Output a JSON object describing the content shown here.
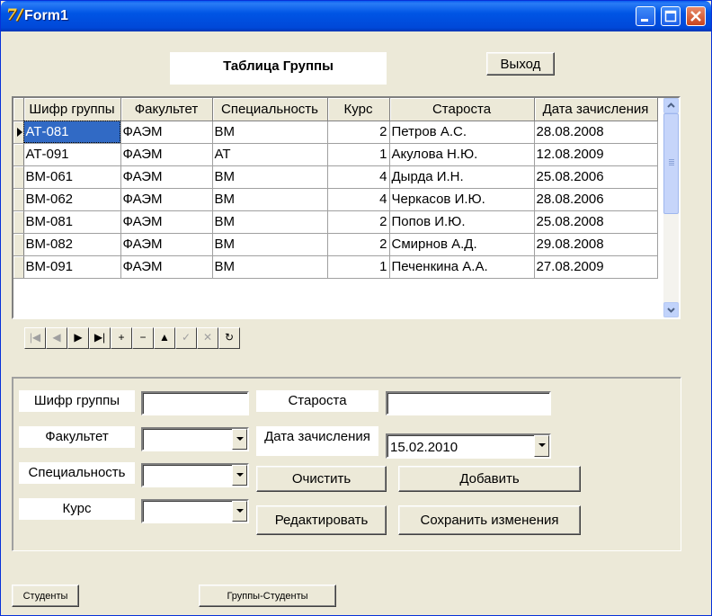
{
  "window": {
    "title": "Form1",
    "app_icon_glyph": "7/",
    "icons": [
      "delphi-app-icon",
      "minimize-icon",
      "maximize-icon",
      "close-icon"
    ]
  },
  "caption": "Таблица Группы",
  "exit_button": "Выход",
  "grid": {
    "columns": [
      "Шифр группы",
      "Факультет",
      "Специальность",
      "Курс",
      "Староста",
      "Дата зачисления"
    ],
    "rows": [
      [
        "АТ-081",
        "ФАЭМ",
        "ВМ",
        "2",
        "Петров А.С.",
        "28.08.2008"
      ],
      [
        "АТ-091",
        "ФАЭМ",
        "АТ",
        "1",
        "Акулова Н.Ю.",
        "12.08.2009"
      ],
      [
        "ВМ-061",
        "ФАЭМ",
        "ВМ",
        "4",
        "Дырда И.Н.",
        "25.08.2006"
      ],
      [
        "ВМ-062",
        "ФАЭМ",
        "ВМ",
        "4",
        "Черкасов И.Ю.",
        "28.08.2006"
      ],
      [
        "ВМ-081",
        "ФАЭМ",
        "ВМ",
        "2",
        "Попов И.Ю.",
        "25.08.2008"
      ],
      [
        "ВМ-082",
        "ФАЭМ",
        "ВМ",
        "2",
        "Смирнов А.Д.",
        "29.08.2008"
      ],
      [
        "ВМ-091",
        "ФАЭМ",
        "ВМ",
        "1",
        "Печенкина А.А.",
        "27.08.2009"
      ]
    ],
    "selected_cell": "АТ-081"
  },
  "navigator": {
    "buttons": [
      {
        "name": "first",
        "glyph": "|◀",
        "enabled": false
      },
      {
        "name": "prior",
        "glyph": "◀",
        "enabled": false
      },
      {
        "name": "next",
        "glyph": "▶",
        "enabled": true
      },
      {
        "name": "last",
        "glyph": "▶|",
        "enabled": true
      },
      {
        "name": "insert",
        "glyph": "+",
        "enabled": true
      },
      {
        "name": "delete",
        "glyph": "−",
        "enabled": true
      },
      {
        "name": "edit",
        "glyph": "▲",
        "enabled": true
      },
      {
        "name": "post",
        "glyph": "✓",
        "enabled": false
      },
      {
        "name": "cancel",
        "glyph": "✕",
        "enabled": false
      },
      {
        "name": "refresh",
        "glyph": "↻",
        "enabled": true
      }
    ]
  },
  "form": {
    "group_code_label": "Шифр группы",
    "group_code_value": "",
    "faculty_label": "Факультет",
    "faculty_value": "",
    "specialty_label": "Специальность",
    "specialty_value": "",
    "course_label": "Курс",
    "course_value": "",
    "headman_label": "Староста",
    "headman_value": "",
    "enroll_date_label": "Дата зачисления",
    "enroll_date_value": "15.02.2010",
    "clear_button": "Очистить",
    "add_button": "Добавить",
    "edit_button": "Редактировать",
    "save_button": "Сохранить изменения"
  },
  "bottom": {
    "students_button": "Студенты",
    "groups_students_button": "Группы-Студенты"
  }
}
